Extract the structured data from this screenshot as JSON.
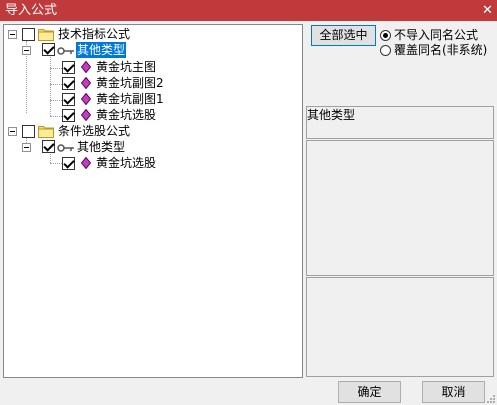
{
  "window": {
    "title": "导入公式",
    "close_glyph": "✕"
  },
  "tree": {
    "root1": {
      "label": "技术指标公式"
    },
    "root1_child": {
      "label": "其他类型"
    },
    "root1_items": [
      "黄金坑主图",
      "黄金坑副图2",
      "黄金坑副图1",
      "黄金坑选股"
    ],
    "root2": {
      "label": "条件选股公式"
    },
    "root2_child": {
      "label": "其他类型"
    },
    "root2_items": [
      "黄金坑选股"
    ]
  },
  "options": {
    "select_all": "全部选中",
    "radio_no_import": "不导入同名公式",
    "radio_overwrite": "覆盖同名(非系统)",
    "selected": "radio_no_import"
  },
  "info": {
    "type_label": "其他类型"
  },
  "buttons": {
    "ok": "确定",
    "cancel": "取消"
  },
  "colors": {
    "title_bar": "#c0393b",
    "selection": "#0078d7"
  },
  "icons": [
    "folder-icon",
    "key-icon",
    "formula-diamond-icon",
    "checkbox",
    "expander",
    "close-icon"
  ]
}
